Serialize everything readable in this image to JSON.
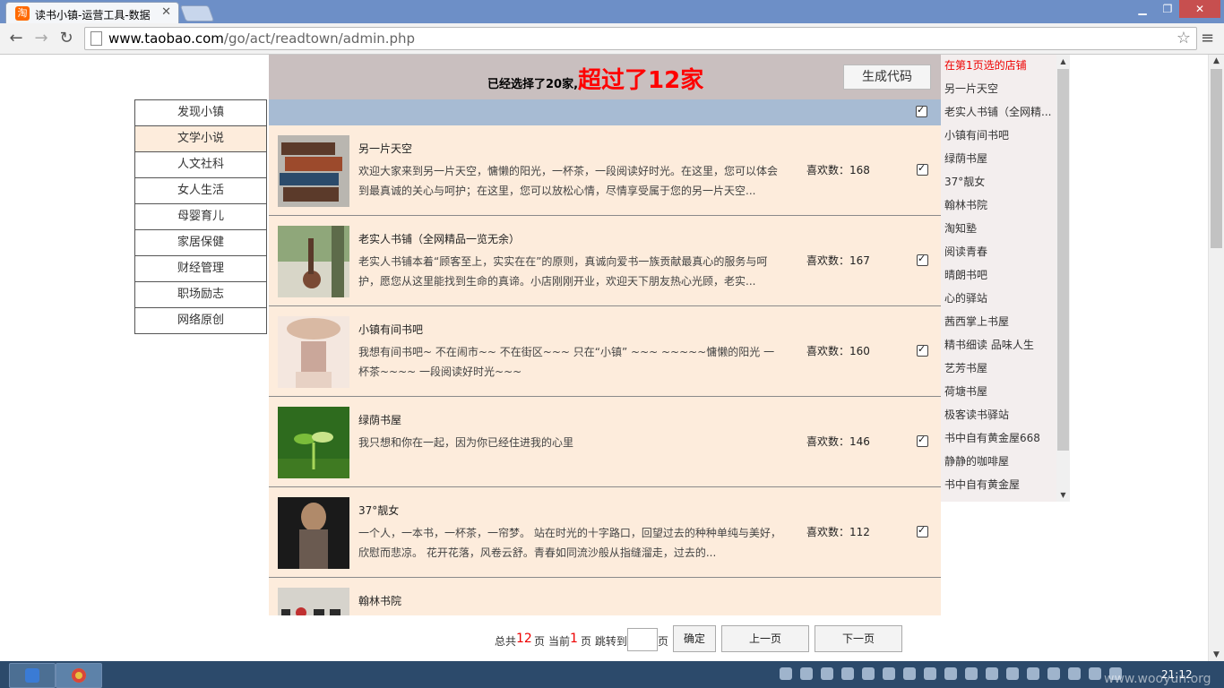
{
  "browser": {
    "tab_title": "读书小镇-运营工具-数据",
    "url_host": "www.taobao.com",
    "url_path": "/go/act/readtown/admin.php"
  },
  "header": {
    "selected_text": "已经选择了20家,",
    "warning_text": "超过了12家",
    "generate_button": "生成代码"
  },
  "categories": [
    {
      "label": "发现小镇"
    },
    {
      "label": "文学小说"
    },
    {
      "label": "人文社科"
    },
    {
      "label": "女人生活"
    },
    {
      "label": "母婴育儿"
    },
    {
      "label": "家居保健"
    },
    {
      "label": "财经管理"
    },
    {
      "label": "职场励志"
    },
    {
      "label": "网络原创"
    }
  ],
  "shops": [
    {
      "name": "另一片天空",
      "desc": "欢迎大家来到另一片天空，慵懒的阳光，一杯茶，一段阅读好时光。在这里，您可以体会到最真诚的关心与呵护；在这里，您可以放松心情，尽情享受属于您的另一片天空...",
      "likes": "喜欢数：168",
      "thumb_colors": [
        "#5b3a2a",
        "#9c4a2c",
        "#2b4b6b"
      ]
    },
    {
      "name": "老实人书铺（全网精品一览无余）",
      "desc": "老实人书铺本着“顾客至上，实实在在”的原则，真诚向爱书一族贡献最真心的服务与呵护，愿您从这里能找到生命的真谛。小店刚刚开业，欢迎天下朋友热心光顾，老实...",
      "likes": "喜欢数：167",
      "thumb_colors": [
        "#8fa77a",
        "#5d6b4a",
        "#d8d6c8"
      ]
    },
    {
      "name": "小镇有间书吧",
      "desc": "我想有间书吧~ 不在闹市~~ 不在街区~~~ 只在“小镇” ~~~ ~~~~~慵懒的阳光 一杯茶~~~~ 一段阅读好时光~~~",
      "likes": "喜欢数：160",
      "thumb_colors": [
        "#e7d1c4",
        "#caa79a",
        "#f4e7df"
      ]
    },
    {
      "name": "绿荫书屋",
      "desc": "我只想和你在一起，因为你已经住进我的心里",
      "likes": "喜欢数：146",
      "thumb_colors": [
        "#2e6b1e",
        "#7bbd3a",
        "#c9e48a"
      ]
    },
    {
      "name": "37°靓女",
      "desc": "一个人，一本书，一杯茶，一帘梦。 站在时光的十字路口，回望过去的种种单纯与美好，欣慰而悲凉。 花开花落，风卷云舒。青春如同流沙般从指缝溜走，过去的...",
      "likes": "喜欢数：112",
      "thumb_colors": [
        "#1a1a1a",
        "#6a5a50",
        "#b08a6a"
      ]
    },
    {
      "name": "翰林书院",
      "desc": "",
      "likes": "",
      "thumb_colors": [
        "#d6d3cc",
        "#c03030",
        "#2b2b2b"
      ]
    }
  ],
  "pager": {
    "total_prefix": "总共",
    "total_pages": "12",
    "page_suffix": "页",
    "current_prefix": "当前",
    "current_page": "1",
    "jump_prefix": "页 跳转到",
    "confirm_button": "确定",
    "prev_button": "上一页",
    "next_button": "下一页"
  },
  "chosen_list": {
    "header": "在第1页选的店铺",
    "items": [
      "另一片天空",
      "老实人书铺（全网精...",
      "小镇有间书吧",
      "绿荫书屋",
      "37°靓女",
      "翰林书院",
      "淘知塾",
      "阅读青春",
      "晴朗书吧",
      "心的驿站",
      "茜西掌上书屋",
      "精书细读 品味人生",
      "艺芳书屋",
      "荷塘书屋",
      "极客读书驿站",
      "书中自有黄金屋668",
      "静静的咖啡屋",
      "书中自有黄金屋"
    ]
  },
  "taskbar": {
    "clock": "21:12",
    "watermark": "www.wooyun.org"
  },
  "colors": {
    "panel_bg": "#fdecdc",
    "header_bg": "#c9bfbf",
    "select_bar_bg": "#a7bbd3",
    "warning": "#ff0000"
  }
}
